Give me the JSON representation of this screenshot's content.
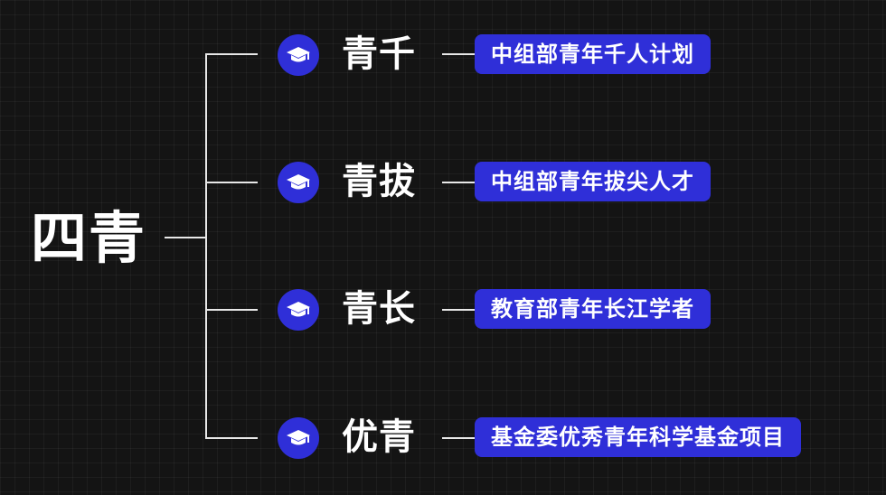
{
  "root": {
    "label": "四青"
  },
  "colors": {
    "background": "#141414",
    "accent": "#2f2fd8",
    "connector": "#e8e8e8",
    "text": "#ffffff"
  },
  "branches": [
    {
      "icon": "graduation-cap-icon",
      "label": "青千",
      "description": "中组部青年千人计划"
    },
    {
      "icon": "graduation-cap-icon",
      "label": "青拔",
      "description": "中组部青年拔尖人才"
    },
    {
      "icon": "graduation-cap-icon",
      "label": "青长",
      "description": "教育部青年长江学者"
    },
    {
      "icon": "graduation-cap-icon",
      "label": "优青",
      "description": "基金委优秀青年科学基金项目"
    }
  ]
}
